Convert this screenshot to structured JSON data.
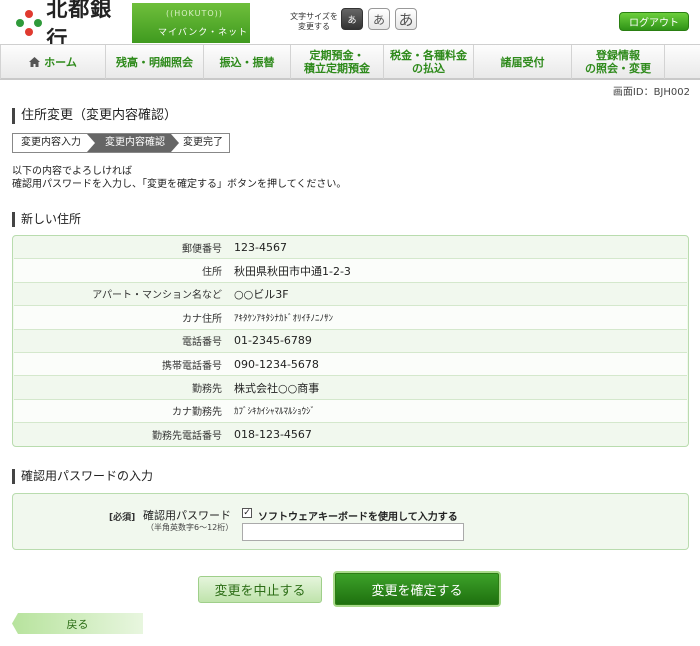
{
  "header": {
    "bank_name": "北都銀行",
    "brand_roman": "((HOKUTO))",
    "brand_sub": "マイバンク・ネット",
    "font_size_label_line1": "文字サイズを",
    "font_size_label_line2": "変更する",
    "font_size_buttons": [
      "あ",
      "あ",
      "あ"
    ],
    "logout_label": "ログアウト",
    "accent_color": "#2e8a1b"
  },
  "nav": {
    "items": [
      {
        "label": "ホーム",
        "icon": "home-icon"
      },
      {
        "label": "残高・明細照会"
      },
      {
        "label": "振込・振替"
      },
      {
        "label": "定期預金・\n積立定期預金"
      },
      {
        "label": "税金・各種料金\nの払込"
      },
      {
        "label": "諸届受付"
      },
      {
        "label": "登録情報\nの照会・変更"
      }
    ]
  },
  "screen_id": "画面ID：BJH002",
  "page_title": "住所変更（変更内容確認）",
  "steps": [
    "変更内容入力",
    "変更内容確認",
    "変更完了"
  ],
  "intro": {
    "line1": "以下の内容でよろしければ",
    "line2": "確認用パスワードを入力し、「変更を確定する」ボタンを押してください。"
  },
  "new_address": {
    "section_title": "新しい住所",
    "rows": [
      {
        "label": "郵便番号",
        "value": "123-4567"
      },
      {
        "label": "住所",
        "value": "秋田県秋田市中通1-2-3"
      },
      {
        "label": "アパート・マンション名など",
        "value": "○○ビル3F"
      },
      {
        "label": "カナ住所",
        "value": "ｱｷﾀｹﾝｱｷﾀｼﾅｶﾄﾞｵﾘｲﾁﾉﾆﾉｻﾝ"
      },
      {
        "label": "電話番号",
        "value": "01-2345-6789"
      },
      {
        "label": "携帯電話番号",
        "value": "090-1234-5678"
      },
      {
        "label": "勤務先",
        "value": "株式会社○○商事"
      },
      {
        "label": "カナ勤務先",
        "value": "ｶﾌﾞｼｷｶｲｼｬﾏﾙﾏﾙｼｮｳｼﾞ"
      },
      {
        "label": "勤務先電話番号",
        "value": "018-123-4567"
      }
    ]
  },
  "password": {
    "section_title": "確認用パスワードの入力",
    "required": "[必須]",
    "label": "確認用パスワード",
    "hint": "（半角英数字6～12桁）",
    "checkbox_label": "ソフトウェアキーボードを使用して入力する",
    "checkbox_checked": true,
    "value": ""
  },
  "buttons": {
    "cancel": "変更を中止する",
    "confirm": "変更を確定する",
    "back": "戻る"
  }
}
